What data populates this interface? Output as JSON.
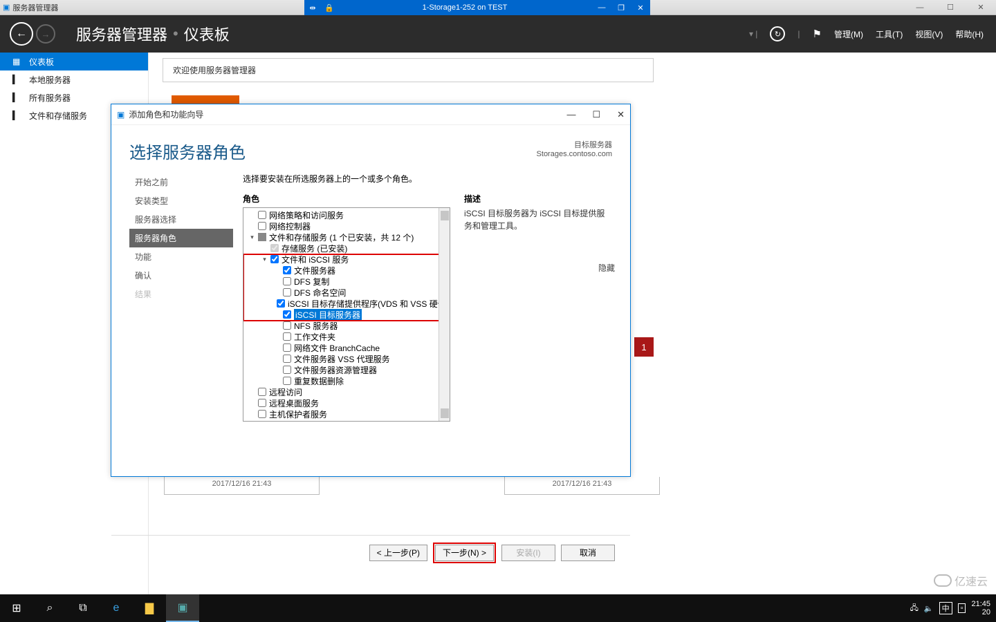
{
  "outer_window": {
    "title": "服务器管理器"
  },
  "vm_bar": {
    "title": "1-Storage1-252 on TEST"
  },
  "header": {
    "breadcrumb_app": "服务器管理器",
    "breadcrumb_page": "仪表板",
    "menu_manage": "管理(M)",
    "menu_tools": "工具(T)",
    "menu_view": "视图(V)",
    "menu_help": "帮助(H)"
  },
  "left_nav": {
    "items": [
      {
        "icon": "▦",
        "label": "仪表板",
        "active": true
      },
      {
        "icon": "▍",
        "label": "本地服务器"
      },
      {
        "icon": "▍",
        "label": "所有服务器"
      },
      {
        "icon": "▍",
        "label": "文件和存储服务"
      }
    ]
  },
  "welcome": "欢迎使用服务器管理器",
  "card_timestamp_1": "2017/12/16 21:43",
  "card_timestamp_2": "2017/12/16 21:43",
  "red_badge": "1",
  "wizard": {
    "title": "添加角色和功能向导",
    "heading": "选择服务器角色",
    "target_label": "目标服务器",
    "target_value": "Storages.contoso.com",
    "instruction": "选择要安装在所选服务器上的一个或多个角色。",
    "roles_header": "角色",
    "desc_header": "描述",
    "desc_text": "iSCSI 目标服务器为 iSCSI 目标提供服务和管理工具。",
    "hide": "隐藏",
    "steps": [
      {
        "label": "开始之前"
      },
      {
        "label": "安装类型"
      },
      {
        "label": "服务器选择"
      },
      {
        "label": "服务器角色",
        "current": true
      },
      {
        "label": "功能"
      },
      {
        "label": "确认"
      },
      {
        "label": "结果",
        "disabled": true
      }
    ],
    "roles": [
      {
        "indent": 0,
        "cb": "unchecked",
        "label": "网络策略和访问服务"
      },
      {
        "indent": 0,
        "cb": "unchecked",
        "label": "网络控制器"
      },
      {
        "indent": 0,
        "cb": "partial",
        "exp": "▾",
        "label": "文件和存储服务 (1 个已安装，共 12 个)"
      },
      {
        "indent": 1,
        "cb": "checked-grey",
        "label": "存储服务 (已安装)"
      },
      {
        "indent": 1,
        "cb": "checked",
        "exp": "▾",
        "label": "文件和 iSCSI 服务",
        "redstart": true
      },
      {
        "indent": 2,
        "cb": "checked",
        "label": "文件服务器"
      },
      {
        "indent": 2,
        "cb": "unchecked",
        "label": "DFS 复制"
      },
      {
        "indent": 2,
        "cb": "unchecked",
        "label": "DFS 命名空间"
      },
      {
        "indent": 2,
        "cb": "checked",
        "label": "iSCSI 目标存储提供程序(VDS 和 VSS 硬件提供"
      },
      {
        "indent": 2,
        "cb": "checked",
        "label": "iSCSI 目标服务器",
        "selected": true,
        "redend": true
      },
      {
        "indent": 2,
        "cb": "unchecked",
        "label": "NFS 服务器"
      },
      {
        "indent": 2,
        "cb": "unchecked",
        "label": "工作文件夹"
      },
      {
        "indent": 2,
        "cb": "unchecked",
        "label": "网络文件 BranchCache"
      },
      {
        "indent": 2,
        "cb": "unchecked",
        "label": "文件服务器 VSS 代理服务"
      },
      {
        "indent": 2,
        "cb": "unchecked",
        "label": "文件服务器资源管理器"
      },
      {
        "indent": 2,
        "cb": "unchecked",
        "label": "重复数据删除"
      },
      {
        "indent": 0,
        "cb": "unchecked",
        "label": "远程访问"
      },
      {
        "indent": 0,
        "cb": "unchecked",
        "label": "远程桌面服务"
      },
      {
        "indent": 0,
        "cb": "unchecked",
        "label": "主机保护者服务"
      }
    ],
    "buttons": {
      "prev": "< 上一步(P)",
      "next": "下一步(N) >",
      "install": "安装(I)",
      "cancel": "取消"
    }
  },
  "taskbar": {
    "time": "21:45",
    "date_short": "20",
    "ime": "中",
    "net": "🖧",
    "vol": "🔈"
  },
  "watermark": "亿速云"
}
